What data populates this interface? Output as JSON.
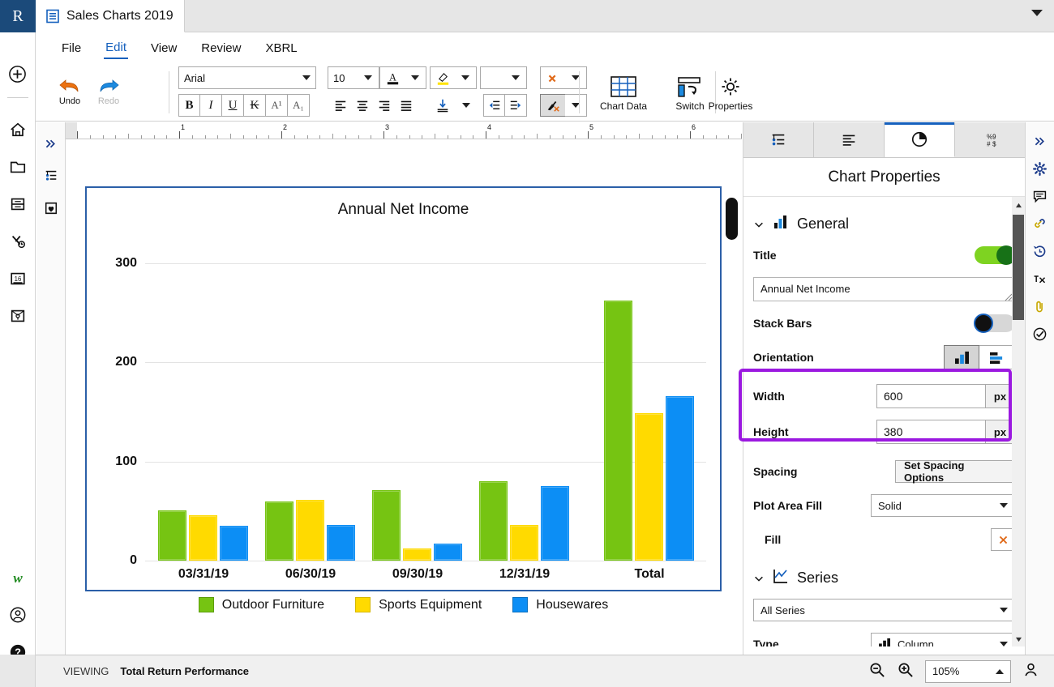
{
  "app": {
    "logo_letter": "R",
    "tab_title": "Sales Charts 2019",
    "doc_icon": "document-icon",
    "tab_caret_icon": "chevron-down-icon"
  },
  "menu": {
    "items": [
      {
        "label": "File",
        "active": false
      },
      {
        "label": "Edit",
        "active": true
      },
      {
        "label": "View",
        "active": false
      },
      {
        "label": "Review",
        "active": false
      },
      {
        "label": "XBRL",
        "active": false
      }
    ]
  },
  "toolbar": {
    "undo_label": "Undo",
    "redo_label": "Redo",
    "font_family_value": "Arial",
    "font_size_value": "10",
    "font_color_icon": "font-color-icon",
    "highlight_icon": "highlighter-icon",
    "bold_label": "B",
    "italic_label": "I",
    "underline_label": "U",
    "strikethrough_label": "K",
    "superscript_label": "A¹",
    "subscript_label": "A₁",
    "align_left_icon": "align-left-icon",
    "align_center_icon": "align-center-icon",
    "align_right_icon": "align-right-icon",
    "align_justify_icon": "align-justify-icon",
    "border_icon": "borders-icon",
    "indent_decrease_icon": "indent-decrease-icon",
    "indent_increase_icon": "indent-increase-icon",
    "clear_format_icon": "clear-formatting-icon",
    "format_painter_icon": "format-painter-icon",
    "chart_data_label": "Chart Data",
    "switch_label": "Switch",
    "properties_label": "Properties"
  },
  "left_rail": {
    "items": [
      {
        "name": "add-icon",
        "glyph": "add"
      },
      {
        "name": "home-icon",
        "glyph": "home"
      },
      {
        "name": "folder-icon",
        "glyph": "folder"
      },
      {
        "name": "database-icon",
        "glyph": "database"
      },
      {
        "name": "percent-clock-icon",
        "glyph": "percent"
      },
      {
        "name": "calendar-16-icon",
        "glyph": "calendar",
        "badge": "16"
      },
      {
        "name": "envelope-key-icon",
        "glyph": "envelope"
      }
    ],
    "bottom_items": [
      {
        "name": "word-icon",
        "glyph": "w"
      },
      {
        "name": "account-icon",
        "glyph": "user"
      },
      {
        "name": "help-icon",
        "glyph": "help"
      }
    ]
  },
  "outline_rail": {
    "items": [
      {
        "name": "expand-panel-icon",
        "glyph": "chevrons-right"
      },
      {
        "name": "outline-icon",
        "glyph": "outline"
      },
      {
        "name": "bookmark-heart-icon",
        "glyph": "heart-box"
      }
    ]
  },
  "right_rail": {
    "items": [
      {
        "name": "expand-panel-icon",
        "glyph": "chevrons-right"
      },
      {
        "name": "gear-icon",
        "glyph": "gear"
      },
      {
        "name": "comment-icon",
        "glyph": "comment"
      },
      {
        "name": "link-icon",
        "glyph": "link"
      },
      {
        "name": "history-icon",
        "glyph": "history"
      },
      {
        "name": "footnote-icon",
        "glyph": "footnote"
      },
      {
        "name": "attachment-icon",
        "glyph": "paperclip"
      },
      {
        "name": "check-circle-icon",
        "glyph": "check-circle"
      }
    ]
  },
  "ruler": {
    "numbers": [
      "1",
      "2",
      "3",
      "4",
      "5",
      "6"
    ]
  },
  "chart_data": {
    "type": "bar",
    "title": "Annual Net Income",
    "categories": [
      "03/31/19",
      "06/30/19",
      "09/30/19",
      "12/31/19",
      "Total"
    ],
    "series": [
      {
        "name": "Outdoor Furniture",
        "color": "#76c412",
        "values": [
          51,
          60,
          71,
          80,
          262
        ]
      },
      {
        "name": "Sports Equipment",
        "color": "#ffda00",
        "values": [
          46,
          61,
          12,
          36,
          149
        ]
      },
      {
        "name": "Housewares",
        "color": "#0c8ef5",
        "values": [
          35,
          36,
          17,
          75,
          166
        ]
      }
    ],
    "yticks": [
      0,
      100,
      200,
      300
    ],
    "ylim": [
      0,
      330
    ],
    "xlabel": "",
    "ylabel": "",
    "grid": true,
    "legend_position": "bottom"
  },
  "panel": {
    "tabs": [
      {
        "name": "tab-outline",
        "icon": "outline-icon",
        "active": false
      },
      {
        "name": "tab-paragraph",
        "icon": "paragraph-icon",
        "active": false
      },
      {
        "name": "tab-chart",
        "icon": "pie-chart-icon",
        "active": true
      },
      {
        "name": "tab-number-format",
        "icon": "number-format-icon",
        "active": false
      }
    ],
    "title": "Chart Properties",
    "general": {
      "section_label": "General",
      "section_icon": "bar-chart-icon",
      "title_label": "Title",
      "title_toggle_state": "on",
      "title_value": "Annual Net Income",
      "stack_bars_label": "Stack Bars",
      "stack_bars_toggle_state": "off",
      "orientation_label": "Orientation",
      "orientation_vertical_icon": "column-chart-icon",
      "orientation_horizontal_icon": "bar-chart-horizontal-icon",
      "orientation_selected": "vertical",
      "width_label": "Width",
      "width_value": "600",
      "width_unit": "px",
      "height_label": "Height",
      "height_value": "380",
      "height_unit": "px",
      "spacing_label": "Spacing",
      "spacing_button": "Set Spacing Options",
      "plot_area_fill_label": "Plot Area Fill",
      "plot_area_fill_value": "Solid",
      "fill_label": "Fill",
      "fill_swatch_icon": "no-fill-icon"
    },
    "series": {
      "section_label": "Series",
      "section_icon": "line-chart-icon",
      "selector_value": "All Series",
      "type_label": "Type",
      "type_value": "Column",
      "type_icon": "column-chart-icon"
    },
    "highlight_color": "#9b19e0"
  },
  "status": {
    "viewing_label": "VIEWING",
    "document_label": "Total Return Performance",
    "zoom_out_icon": "zoom-out-icon",
    "zoom_in_icon": "zoom-in-icon",
    "zoom_value": "105%",
    "account_icon": "account-icon"
  }
}
